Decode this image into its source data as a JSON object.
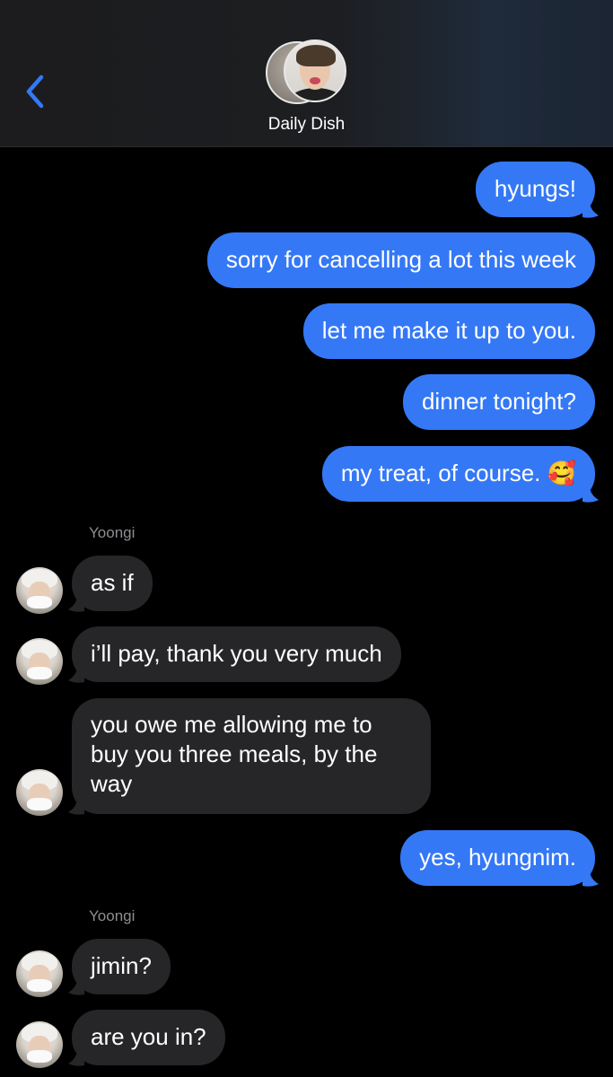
{
  "header": {
    "group_name": "Daily Dish",
    "back_icon": "chevron-left-icon",
    "accent_color": "#3478f6"
  },
  "messages": [
    {
      "direction": "out",
      "text": "hyungs!"
    },
    {
      "direction": "out",
      "text": "sorry for cancelling a lot this week"
    },
    {
      "direction": "out",
      "text": "let me make it up to you."
    },
    {
      "direction": "out",
      "text": "dinner tonight?"
    },
    {
      "direction": "out",
      "text": "my treat, of course. 🥰"
    },
    {
      "direction": "in",
      "sender": "Yoongi",
      "text": "as if"
    },
    {
      "direction": "in",
      "text": "i’ll pay, thank you very much"
    },
    {
      "direction": "in",
      "text": "you owe me allowing me to buy you three meals, by the way"
    },
    {
      "direction": "out",
      "text": "yes, hyungnim."
    },
    {
      "direction": "in",
      "sender": "Yoongi",
      "text": "jimin?"
    },
    {
      "direction": "in",
      "text": "are you in?"
    }
  ],
  "colors": {
    "outgoing_bubble": "#3478f6",
    "incoming_bubble": "#262628",
    "sender_label": "#8e8e93",
    "background": "#000000"
  }
}
